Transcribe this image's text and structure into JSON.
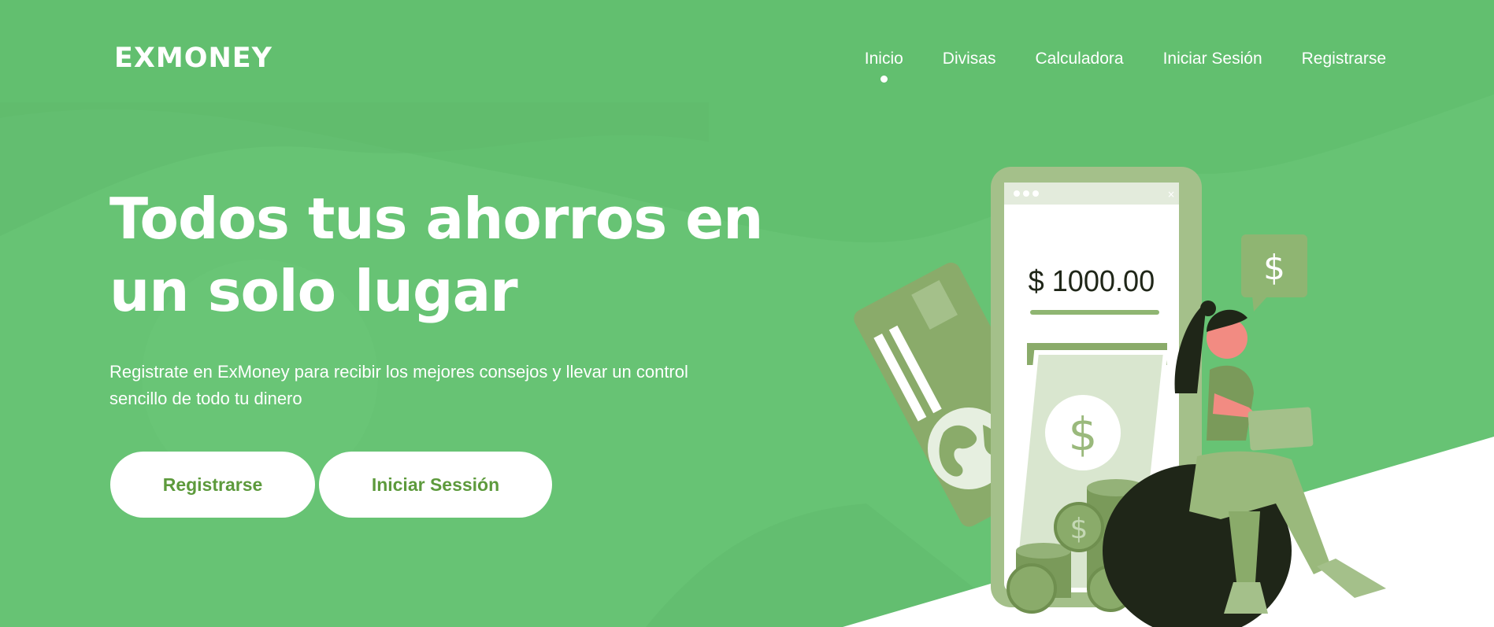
{
  "brand": {
    "logo_text": "EXMONEY"
  },
  "nav": {
    "items": [
      {
        "label": "Inicio",
        "active": true
      },
      {
        "label": "Divisas",
        "active": false
      },
      {
        "label": "Calculadora",
        "active": false
      },
      {
        "label": "Iniciar Sesión",
        "active": false
      },
      {
        "label": "Registrarse",
        "active": false
      }
    ]
  },
  "hero": {
    "title_line1": "Todos tus ahorros en",
    "title_line2": "un solo lugar",
    "subtitle_line1": "Registrate en ExMoney para recibir los mejores consejos y llevar un control",
    "subtitle_line2": "sencillo de todo tu dinero",
    "primary_button": "Registrarse",
    "secondary_button": "Iniciar Sessión"
  },
  "illustration": {
    "phone_amount": "$ 1000.00",
    "bubble_symbol": "$",
    "bill_symbol": "$",
    "coin_symbol": "$"
  },
  "colors": {
    "background": "#67c374",
    "accent_text": "#5d9a3c",
    "illustration_green": "#8fb572",
    "illustration_dark": "#1f2618"
  }
}
